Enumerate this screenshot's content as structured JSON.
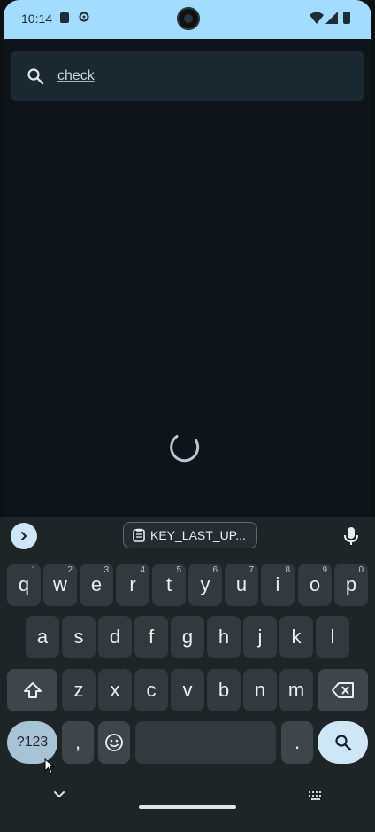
{
  "status_bar": {
    "time": "10:14"
  },
  "search": {
    "query": "check"
  },
  "keyboard": {
    "clipboard_chip": "KEY_LAST_UP...",
    "row1": [
      {
        "key": "q",
        "hint": "1"
      },
      {
        "key": "w",
        "hint": "2"
      },
      {
        "key": "e",
        "hint": "3"
      },
      {
        "key": "r",
        "hint": "4"
      },
      {
        "key": "t",
        "hint": "5"
      },
      {
        "key": "y",
        "hint": "6"
      },
      {
        "key": "u",
        "hint": "7"
      },
      {
        "key": "i",
        "hint": "8"
      },
      {
        "key": "o",
        "hint": "9"
      },
      {
        "key": "p",
        "hint": "0"
      }
    ],
    "row2": [
      "a",
      "s",
      "d",
      "f",
      "g",
      "h",
      "j",
      "k",
      "l"
    ],
    "row3": [
      "z",
      "x",
      "c",
      "v",
      "b",
      "n",
      "m"
    ],
    "symbols_label": "?123",
    "comma": ",",
    "period": "."
  }
}
